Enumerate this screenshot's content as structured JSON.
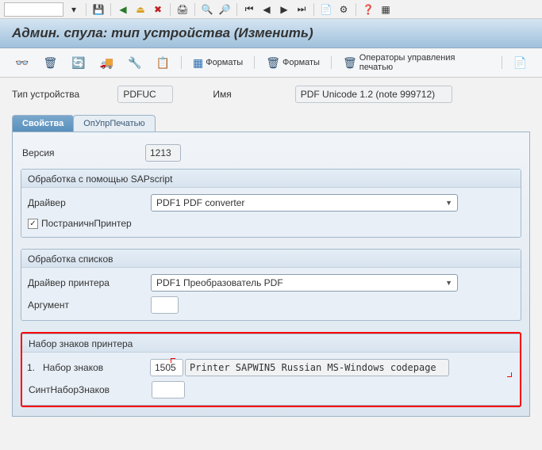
{
  "title": "Админ. спула: тип устройства (Изменить)",
  "app_toolbar": {
    "formats1": "Форматы",
    "formats2": "Форматы",
    "print_ops": "Операторы управления печатью"
  },
  "header": {
    "device_type_label": "Тип устройства",
    "device_type_value": "PDFUC",
    "name_label": "Имя",
    "name_value": "PDF Unicode 1.2  (note 999712)"
  },
  "tabs": {
    "props": "Свойства",
    "printops": "ОпУпрПечатью"
  },
  "props": {
    "version_label": "Версия",
    "version_value": "1213",
    "sapscript_group": "Обработка с помощью SAPscript",
    "driver_label": "Драйвер",
    "driver_value": "PDF1 PDF converter",
    "page_printer_label": "ПостраничнПринтер",
    "lists_group": "Обработка списков",
    "printer_driver_label": "Драйвер принтера",
    "printer_driver_value": "PDF1 Преобразователь PDF",
    "argument_label": "Аргумент",
    "argument_value": "",
    "charset_group": "Набор знаков принтера",
    "charset_row_prefix": "1.",
    "charset_label": "Набор знаков",
    "charset_code": "1505",
    "charset_desc": "Printer SAPWIN5  Russian MS-Windows codepage",
    "synt_label": "СинтНаборЗнаков",
    "synt_value": ""
  }
}
